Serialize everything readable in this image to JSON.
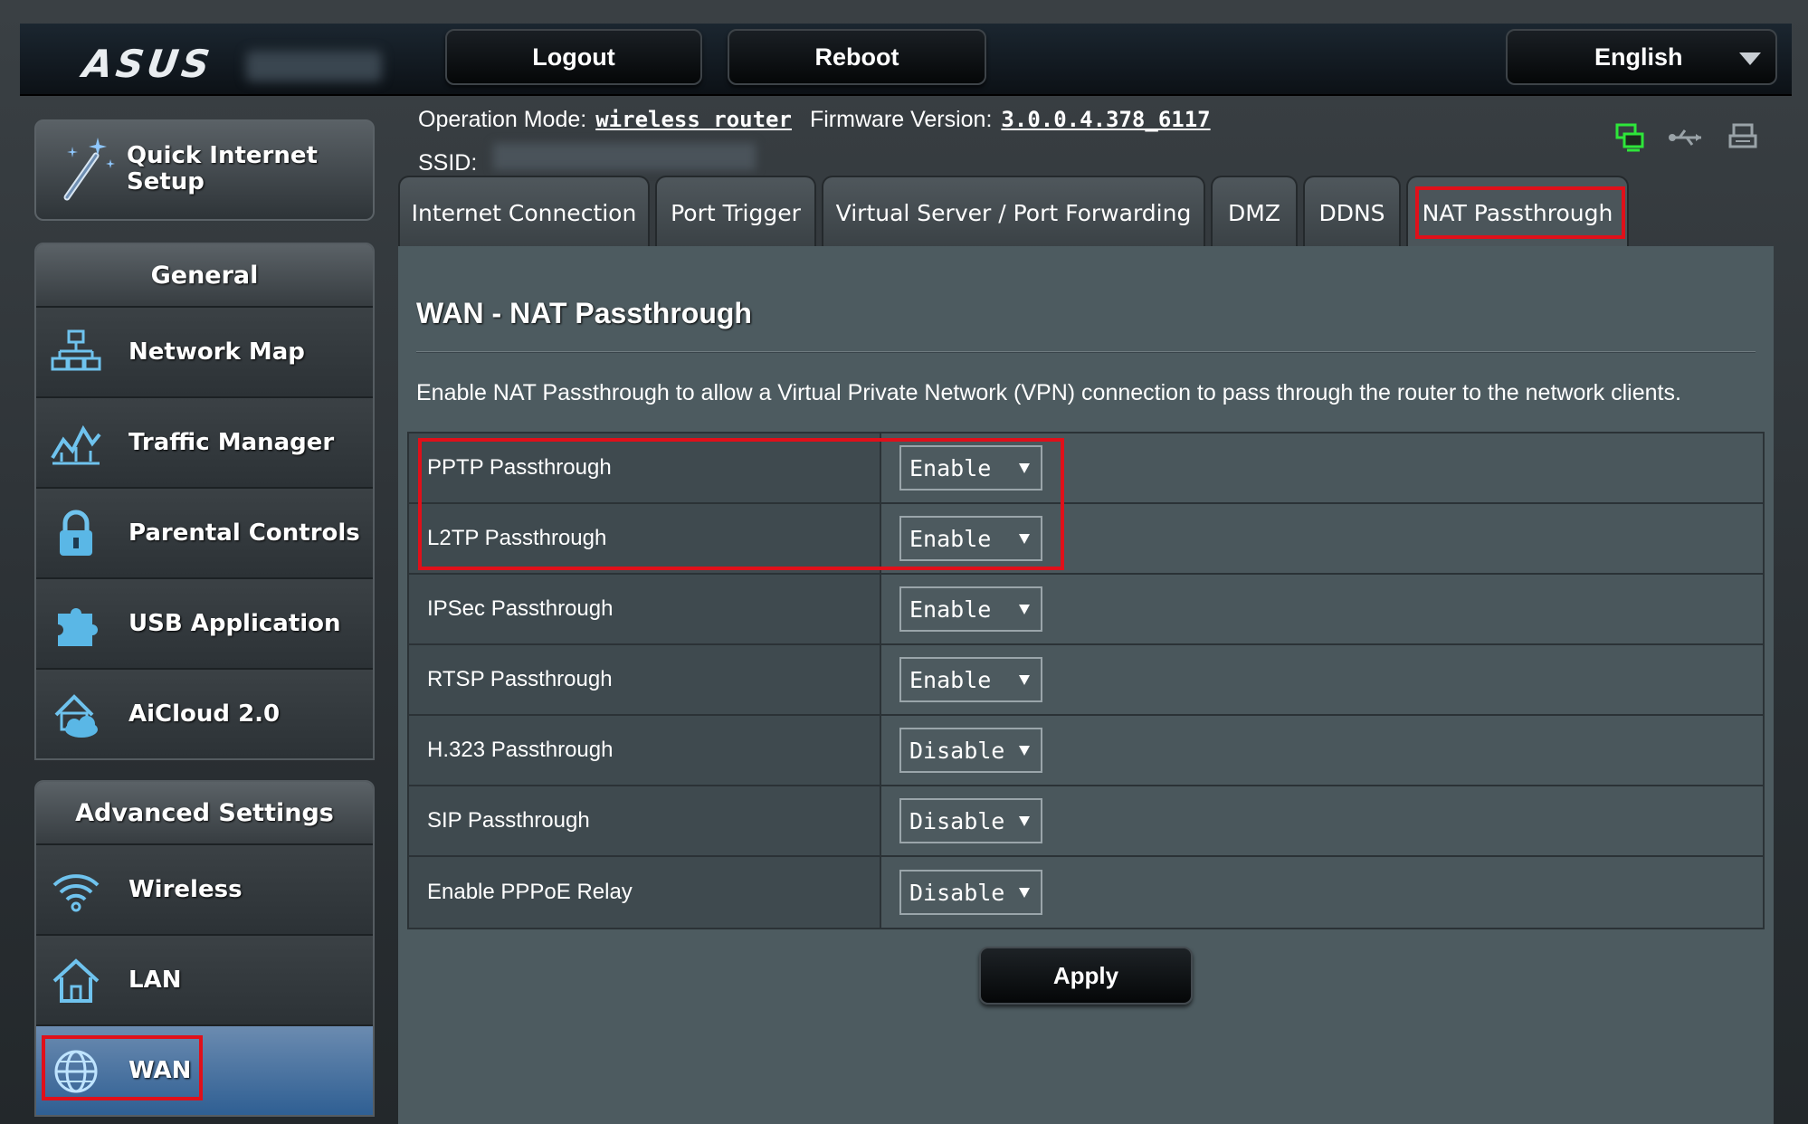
{
  "brand": {
    "logo": "ASUS"
  },
  "topbar": {
    "logout_label": "Logout",
    "reboot_label": "Reboot",
    "language_selected": "English"
  },
  "info": {
    "operation_mode_key": "Operation Mode:",
    "operation_mode_value": "wireless router",
    "firmware_key": "Firmware Version:",
    "firmware_value": "3.0.0.4.378_6117",
    "ssid_key": "SSID:"
  },
  "status_icons": [
    "network-status-icon",
    "usb-status-icon",
    "printer-status-icon"
  ],
  "sidebar": {
    "quick_setup_label": "Quick Internet Setup",
    "general_header": "General",
    "general_items": [
      {
        "label": "Network Map",
        "icon": "network-map-icon"
      },
      {
        "label": "Traffic Manager",
        "icon": "traffic-manager-icon"
      },
      {
        "label": "Parental Controls",
        "icon": "lock-icon"
      },
      {
        "label": "USB Application",
        "icon": "puzzle-icon"
      },
      {
        "label": "AiCloud 2.0",
        "icon": "cloud-house-icon"
      }
    ],
    "advanced_header": "Advanced Settings",
    "advanced_items": [
      {
        "label": "Wireless",
        "icon": "wifi-icon"
      },
      {
        "label": "LAN",
        "icon": "house-icon"
      },
      {
        "label": "WAN",
        "icon": "globe-icon",
        "active": true
      }
    ]
  },
  "tabs": [
    {
      "label": "Internet Connection"
    },
    {
      "label": "Port Trigger"
    },
    {
      "label": "Virtual Server / Port Forwarding"
    },
    {
      "label": "DMZ"
    },
    {
      "label": "DDNS"
    },
    {
      "label": "NAT Passthrough",
      "active": true
    }
  ],
  "main": {
    "title": "WAN - NAT Passthrough",
    "description": "Enable NAT Passthrough to allow a Virtual Private Network (VPN) connection to pass through the router to the network clients.",
    "settings": [
      {
        "label": "PPTP Passthrough",
        "value": "Enable"
      },
      {
        "label": "L2TP Passthrough",
        "value": "Enable"
      },
      {
        "label": "IPSec Passthrough",
        "value": "Enable"
      },
      {
        "label": "RTSP Passthrough",
        "value": "Enable"
      },
      {
        "label": "H.323 Passthrough",
        "value": "Disable"
      },
      {
        "label": "SIP Passthrough",
        "value": "Disable"
      },
      {
        "label": "Enable PPPoE Relay",
        "value": "Disable"
      }
    ],
    "apply_label": "Apply"
  },
  "colors": {
    "highlight": "#e0101a",
    "active_nav": "#2f5f93",
    "panel_bg": "#4d5b60"
  }
}
